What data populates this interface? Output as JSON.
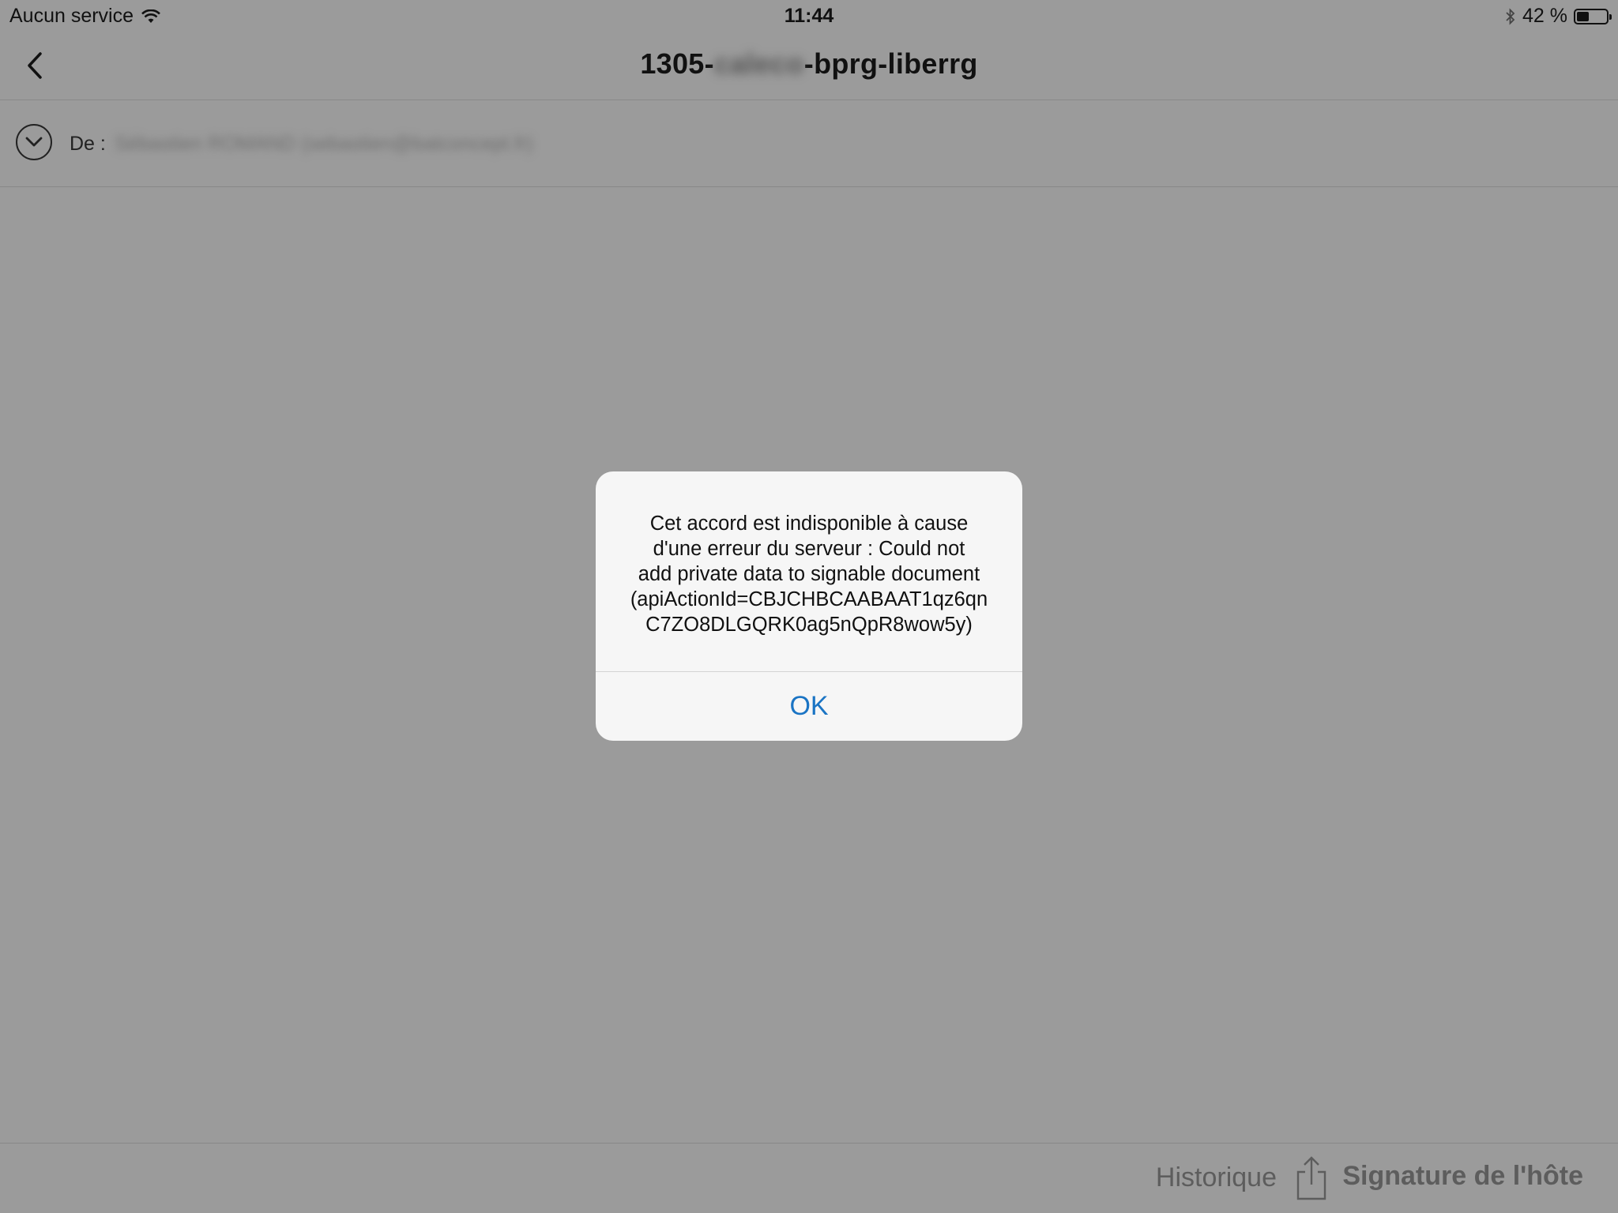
{
  "status_bar": {
    "carrier": "Aucun service",
    "time": "11:44",
    "battery_percent_label": "42 %",
    "battery_level": 0.42
  },
  "nav": {
    "title_prefix": "1305-",
    "title_redacted": "caleco",
    "title_suffix": "-bprg-liberrg"
  },
  "from_row": {
    "label": "De :",
    "value_redacted": "Sébastien ROMAND (sebastien@batconcept.fr)"
  },
  "alert": {
    "message_lines": [
      "Cet accord est indisponible à cause",
      "d'une erreur du serveur : Could not",
      "add private data to signable document",
      "(apiActionId=CBJCHBCAABAAT1qz6qn",
      "C7ZO8DLGQRK0ag5nQpR8wow5y)"
    ],
    "ok_label": "OK"
  },
  "toolbar": {
    "history_label": "Historique",
    "signature_label": "Signature de l'hôte"
  },
  "icons": {
    "wifi": "wifi-icon",
    "bluetooth": "bluetooth-icon",
    "battery": "battery-icon",
    "back": "chevron-left-icon",
    "expand": "chevron-down-circle-icon",
    "share": "share-icon"
  },
  "colors": {
    "dim_background": "#9b9b9b",
    "alert_background": "#f6f6f6",
    "ok_button": "#1a74c4"
  }
}
